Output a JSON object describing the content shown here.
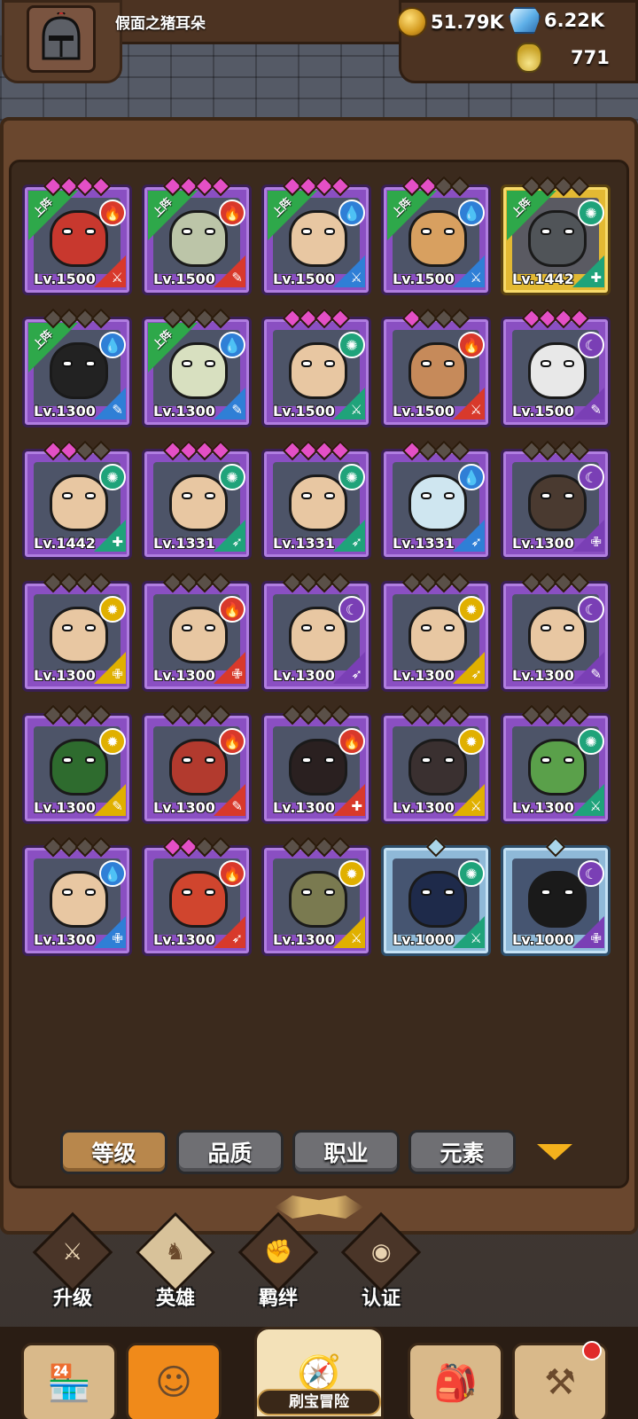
{
  "player": {
    "name": "假面之猪耳朵",
    "avatar_icon": "knight-helmet-icon"
  },
  "resources": {
    "gold": "51.79K",
    "gems": "6.22K",
    "potion": "771"
  },
  "deploy_label": "上阵",
  "heroes": [
    {
      "level": "Lv.1500",
      "frame": "purple",
      "deployed": true,
      "element": "fire",
      "class": "sword",
      "stars": [
        "pink",
        "pink",
        "pink",
        "pink"
      ],
      "skin": "#c8382e"
    },
    {
      "level": "Lv.1500",
      "frame": "purple",
      "deployed": true,
      "element": "fire",
      "class": "staff",
      "stars": [
        "pink",
        "pink",
        "pink",
        "pink"
      ],
      "skin": "#bcc5a8"
    },
    {
      "level": "Lv.1500",
      "frame": "purple",
      "deployed": true,
      "element": "water",
      "class": "sword",
      "stars": [
        "pink",
        "pink",
        "pink",
        "pink"
      ],
      "skin": "#e8c7a2"
    },
    {
      "level": "Lv.1500",
      "frame": "purple",
      "deployed": true,
      "element": "water",
      "class": "sword",
      "stars": [
        "pink",
        "pink",
        "gray",
        "gray"
      ],
      "skin": "#d8a060"
    },
    {
      "level": "Lv.1442",
      "frame": "gold",
      "deployed": true,
      "element": "wind",
      "class": "shield",
      "stars": [
        "gray",
        "gray",
        "gray",
        "gray"
      ],
      "skin": "#505458"
    },
    {
      "level": "Lv.1300",
      "frame": "purple",
      "deployed": true,
      "element": "water",
      "class": "staff",
      "stars": [
        "gray",
        "gray",
        "gray",
        "gray"
      ],
      "skin": "#222"
    },
    {
      "level": "Lv.1300",
      "frame": "purple",
      "deployed": true,
      "element": "water",
      "class": "staff",
      "stars": [
        "gray",
        "gray",
        "gray",
        "gray"
      ],
      "skin": "#d8e0c0"
    },
    {
      "level": "Lv.1500",
      "frame": "purple",
      "deployed": false,
      "element": "wind",
      "class": "sword",
      "stars": [
        "pink",
        "pink",
        "pink",
        "pink"
      ],
      "skin": "#e8c7a2"
    },
    {
      "level": "Lv.1500",
      "frame": "purple",
      "deployed": false,
      "element": "fire",
      "class": "sword",
      "stars": [
        "pink",
        "gray",
        "gray",
        "gray"
      ],
      "skin": "#c68a5a"
    },
    {
      "level": "Lv.1500",
      "frame": "purple",
      "deployed": false,
      "element": "dark",
      "class": "staff",
      "stars": [
        "pink",
        "pink",
        "pink",
        "pink"
      ],
      "skin": "#e8e8e8"
    },
    {
      "level": "Lv.1442",
      "frame": "purple",
      "deployed": false,
      "element": "wind",
      "class": "shield",
      "stars": [
        "pink",
        "pink",
        "gray",
        "gray"
      ],
      "skin": "#e8c7a2"
    },
    {
      "level": "Lv.1331",
      "frame": "purple",
      "deployed": false,
      "element": "wind",
      "class": "bow",
      "stars": [
        "pink",
        "pink",
        "pink",
        "pink"
      ],
      "skin": "#e8c7a2"
    },
    {
      "level": "Lv.1331",
      "frame": "purple",
      "deployed": false,
      "element": "wind",
      "class": "bow",
      "stars": [
        "pink",
        "pink",
        "pink",
        "pink"
      ],
      "skin": "#e8c7a2"
    },
    {
      "level": "Lv.1331",
      "frame": "purple",
      "deployed": false,
      "element": "water",
      "class": "bow",
      "stars": [
        "pink",
        "gray",
        "gray",
        "gray"
      ],
      "skin": "#cfe6f0"
    },
    {
      "level": "Lv.1300",
      "frame": "purple",
      "deployed": false,
      "element": "dark",
      "class": "cross",
      "stars": [
        "gray",
        "gray",
        "gray",
        "gray"
      ],
      "skin": "#4a3a30"
    },
    {
      "level": "Lv.1300",
      "frame": "purple",
      "deployed": false,
      "element": "light",
      "class": "cross",
      "stars": [
        "gray",
        "gray",
        "gray",
        "gray"
      ],
      "skin": "#e8c7a2"
    },
    {
      "level": "Lv.1300",
      "frame": "purple",
      "deployed": false,
      "element": "fire",
      "class": "cross",
      "stars": [
        "gray",
        "gray",
        "gray",
        "gray"
      ],
      "skin": "#e8c7a2"
    },
    {
      "level": "Lv.1300",
      "frame": "purple",
      "deployed": false,
      "element": "dark",
      "class": "bow",
      "stars": [
        "gray",
        "gray",
        "gray",
        "gray"
      ],
      "skin": "#e8c7a2"
    },
    {
      "level": "Lv.1300",
      "frame": "purple",
      "deployed": false,
      "element": "light",
      "class": "bow",
      "stars": [
        "gray",
        "gray",
        "gray",
        "gray"
      ],
      "skin": "#e8c7a2"
    },
    {
      "level": "Lv.1300",
      "frame": "purple",
      "deployed": false,
      "element": "dark",
      "class": "staff",
      "stars": [
        "gray",
        "gray",
        "gray",
        "gray"
      ],
      "skin": "#e8c7a2"
    },
    {
      "level": "Lv.1300",
      "frame": "purple",
      "deployed": false,
      "element": "light",
      "class": "staff",
      "stars": [
        "gray",
        "gray",
        "gray",
        "gray"
      ],
      "skin": "#2e6b2e"
    },
    {
      "level": "Lv.1300",
      "frame": "purple",
      "deployed": false,
      "element": "fire",
      "class": "staff",
      "stars": [
        "gray",
        "gray",
        "gray",
        "gray"
      ],
      "skin": "#b23a2e"
    },
    {
      "level": "Lv.1300",
      "frame": "purple",
      "deployed": false,
      "element": "fire",
      "class": "shield",
      "stars": [
        "gray",
        "gray",
        "gray",
        "gray"
      ],
      "skin": "#2a2020"
    },
    {
      "level": "Lv.1300",
      "frame": "purple",
      "deployed": false,
      "element": "light",
      "class": "sword",
      "stars": [
        "gray",
        "gray",
        "gray",
        "gray"
      ],
      "skin": "#3a3030"
    },
    {
      "level": "Lv.1300",
      "frame": "purple",
      "deployed": false,
      "element": "wind",
      "class": "sword",
      "stars": [
        "gray",
        "gray",
        "gray",
        "gray"
      ],
      "skin": "#5aa04a"
    },
    {
      "level": "Lv.1300",
      "frame": "purple",
      "deployed": false,
      "element": "water",
      "class": "cross",
      "stars": [
        "gray",
        "gray",
        "gray",
        "gray"
      ],
      "skin": "#e8c7a2"
    },
    {
      "level": "Lv.1300",
      "frame": "purple",
      "deployed": false,
      "element": "fire",
      "class": "bow",
      "stars": [
        "pink",
        "pink",
        "gray",
        "gray"
      ],
      "skin": "#d0452e"
    },
    {
      "level": "Lv.1300",
      "frame": "purple",
      "deployed": false,
      "element": "light",
      "class": "sword",
      "stars": [
        "gray",
        "gray",
        "gray",
        "gray"
      ],
      "skin": "#7a7a50"
    },
    {
      "level": "Lv.1000",
      "frame": "blue",
      "deployed": false,
      "element": "wind",
      "class": "sword",
      "stars": [
        "silver"
      ],
      "skin": "#1e2a4a"
    },
    {
      "level": "Lv.1000",
      "frame": "blue",
      "deployed": false,
      "element": "dark",
      "class": "cross",
      "stars": [
        "silver"
      ],
      "skin": "#1a1a1a"
    }
  ],
  "element_colors": {
    "fire": "#d8392b",
    "water": "#2f7fd6",
    "wind": "#1fa37a",
    "dark": "#7a3fb5",
    "light": "#e0b000"
  },
  "element_glyphs": {
    "fire": "🔥",
    "water": "💧",
    "wind": "✺",
    "dark": "☾",
    "light": "✹"
  },
  "class_glyphs": {
    "sword": "⚔",
    "staff": "✎",
    "shield": "✚",
    "bow": "➶",
    "cross": "✙"
  },
  "filter_tabs": [
    "等级",
    "品质",
    "职业",
    "元素"
  ],
  "active_filter": 0,
  "sub_nav": [
    {
      "label": "升级",
      "icon": "sword-icon",
      "glyph": "⚔"
    },
    {
      "label": "英雄",
      "icon": "hero-icon",
      "glyph": "♞"
    },
    {
      "label": "羁绊",
      "icon": "fist-icon",
      "glyph": "✊"
    },
    {
      "label": "认证",
      "icon": "eye-icon",
      "glyph": "◉"
    }
  ],
  "active_sub_nav": 1,
  "bottom_nav": [
    {
      "name": "shop",
      "icon": "shop-icon",
      "glyph": "🏪"
    },
    {
      "name": "heroes",
      "icon": "hero-portrait-icon",
      "glyph": "☺"
    },
    {
      "name": "adventure",
      "icon": "treasure-map-icon",
      "glyph": "🧭",
      "label": "刷宝冒险"
    },
    {
      "name": "inventory",
      "icon": "backpack-icon",
      "glyph": "🎒"
    },
    {
      "name": "forge",
      "icon": "hammer-icon",
      "glyph": "⚒"
    }
  ]
}
